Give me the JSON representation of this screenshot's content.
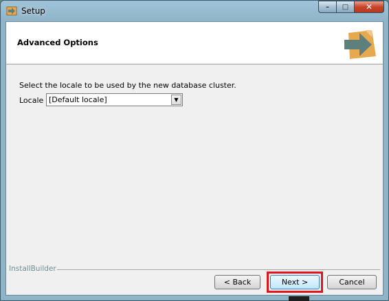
{
  "window": {
    "title": "Setup"
  },
  "caption_buttons": {
    "minimize": "–",
    "maximize": "□",
    "close": "✕"
  },
  "header": {
    "title": "Advanced Options"
  },
  "content": {
    "description": "Select the locale to be used by the new database cluster.",
    "locale_label": "Locale",
    "locale_value": "[Default locale]"
  },
  "footer": {
    "brand": "InstallBuilder",
    "back_label": "< Back",
    "next_label": "Next >",
    "cancel_label": "Cancel"
  },
  "colors": {
    "highlight": "#e0141e",
    "logo_box": "#e7a94f",
    "logo_arrow": "#5f7f7c"
  }
}
